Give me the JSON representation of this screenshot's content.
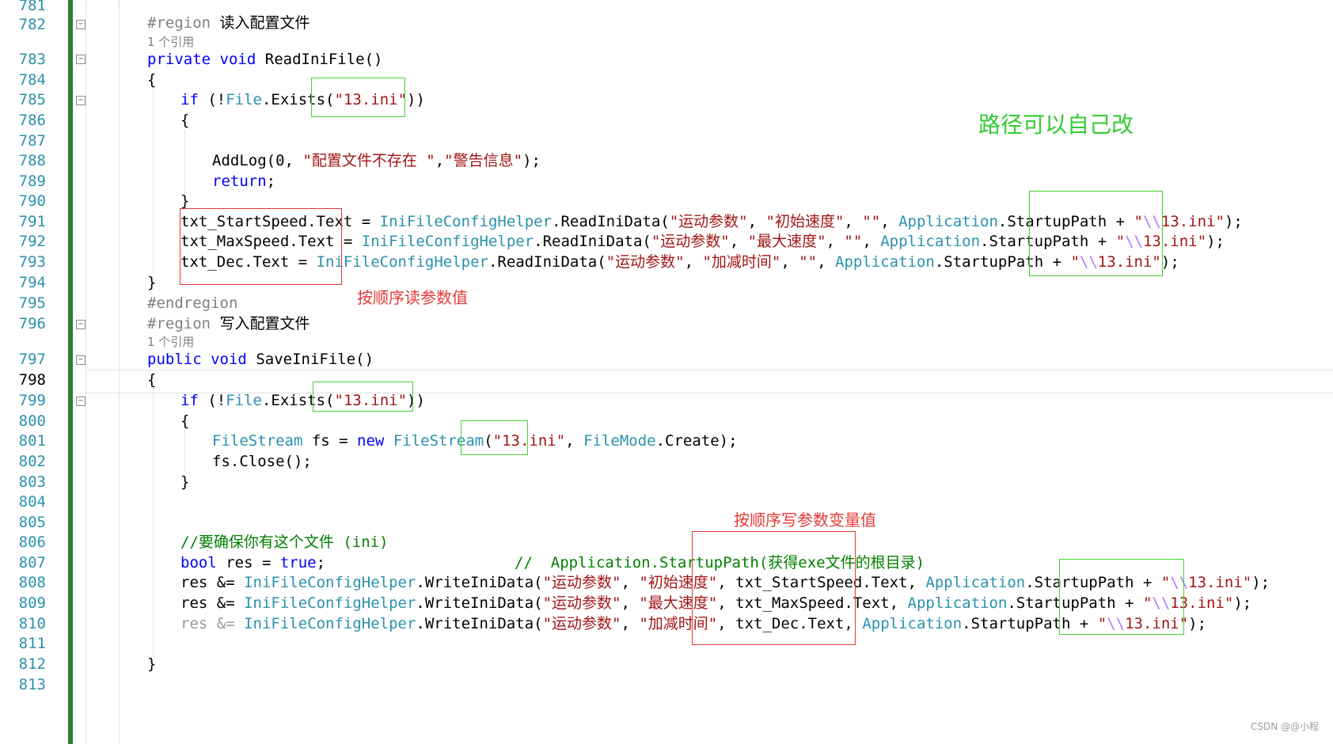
{
  "line_numbers": [
    "781",
    "782",
    "783",
    "784",
    "785",
    "786",
    "787",
    "788",
    "789",
    "790",
    "791",
    "792",
    "793",
    "794",
    "795",
    "796",
    "797",
    "798",
    "799",
    "800",
    "801",
    "802",
    "803",
    "804",
    "805",
    "806",
    "807",
    "808",
    "809",
    "810",
    "811",
    "812",
    "813"
  ],
  "current_line": "798",
  "code": {
    "l782": {
      "pp": "#region",
      "rest": " 读入配置文件"
    },
    "lens1": "1 个引用",
    "l783": {
      "kw1": "private",
      "kw2": "void",
      "name": "ReadIniFile()"
    },
    "l784": "{",
    "l785": {
      "kw": "if",
      "p1": " (!",
      "ty": "File",
      "p2": ".Exists(",
      "st": "\"13.ini\"",
      "p3": "))"
    },
    "l786": "{",
    "l788": {
      "fn": "AddLog(0, ",
      "st1": "\"配置文件不存在 \"",
      "comma": ",",
      "st2": "\"警告信息\"",
      "end": ");"
    },
    "l789": {
      "kw": "return",
      "end": ";"
    },
    "l790": "}",
    "l791": {
      "lhs": "txt_StartSpeed.Text",
      "eq": " = ",
      "ty": "IniFileConfigHelper",
      "call": ".ReadIniData(",
      "s1": "\"运动参数\"",
      "c1": ", ",
      "s2": "\"初始速度\"",
      "c2": ", ",
      "s3": "\"\"",
      "c3": ", ",
      "ty2": "Application",
      "prop": ".StartupPath + ",
      "s4a": "\"",
      "esc": "\\\\",
      "s4b": "13.ini\"",
      "end": ");"
    },
    "l792": {
      "lhs": "txt_MaxSpeed.Text",
      "eq": " = ",
      "ty": "IniFileConfigHelper",
      "call": ".ReadIniData(",
      "s1": "\"运动参数\"",
      "c1": ", ",
      "s2": "\"最大速度\"",
      "c2": ", ",
      "s3": "\"\"",
      "c3": ", ",
      "ty2": "Application",
      "prop": ".StartupPath + ",
      "s4a": "\"",
      "esc": "\\\\",
      "s4b": "13.ini\"",
      "end": ");"
    },
    "l793": {
      "lhs": "txt_Dec.Text",
      "eq": " = ",
      "ty": "IniFileConfigHelper",
      "call": ".ReadIniData(",
      "s1": "\"运动参数\"",
      "c1": ", ",
      "s2": "\"加减时间\"",
      "c2": ", ",
      "s3": "\"\"",
      "c3": ", ",
      "ty2": "Application",
      "prop": ".StartupPath + ",
      "s4a": "\"",
      "esc": "\\\\",
      "s4b": "13.ini\"",
      "end": ");"
    },
    "l794": "}",
    "l795": "#endregion",
    "l796": {
      "pp": "#region",
      "rest": " 写入配置文件"
    },
    "lens2": "1 个引用",
    "l797": {
      "kw1": "public",
      "kw2": "void",
      "name": "SaveIniFile()"
    },
    "l798": "{",
    "l799": {
      "kw": "if",
      "p1": " (!",
      "ty": "File",
      "p2": ".Exists(",
      "st": "\"13.ini\"",
      "p3": "))"
    },
    "l800": "{",
    "l801": {
      "ty1": "FileStream",
      "p1": " fs = ",
      "kw": "new",
      "sp": " ",
      "ty2": "FileStream",
      "p2": "(",
      "st": "\"13.ini\"",
      "p3": ", ",
      "ty3": "FileMode",
      "p4": ".Create);"
    },
    "l802": "fs.Close();",
    "l803": "}",
    "l806": "//要确保你有这个文件 (ini)",
    "l807": {
      "kw": "bool",
      "p1": " res = ",
      "kw2": "true",
      "p2": ";",
      "cm": "//  Application.StartupPath(获得exe文件的根目录)"
    },
    "l808": {
      "lhs": "res &= ",
      "ty": "IniFileConfigHelper",
      "call": ".WriteIniData(",
      "s1": "\"运动参数\"",
      "c1": ", ",
      "s2": "\"初始速度\"",
      "c2": ", ",
      "arg": "txt_StartSpeed.Text",
      "c3": ", ",
      "ty2": "Application",
      "prop": ".StartupPath + ",
      "s4a": "\"",
      "esc": "\\\\",
      "s4b": "13.ini\"",
      "end": ");"
    },
    "l809": {
      "lhs": "res &= ",
      "ty": "IniFileConfigHelper",
      "call": ".WriteIniData(",
      "s1": "\"运动参数\"",
      "c1": ", ",
      "s2": "\"最大速度\"",
      "c2": ", ",
      "arg": "txt_MaxSpeed.Text",
      "c3": ", ",
      "ty2": "Application",
      "prop": ".StartupPath + ",
      "s4a": "\"",
      "esc": "\\\\",
      "s4b": "13.ini\"",
      "end": ");"
    },
    "l810": {
      "lhs": "res &= ",
      "ty": "IniFileConfigHelper",
      "call": ".WriteIniData(",
      "s1": "\"运动参数\"",
      "c1": ", ",
      "s2": "\"加减时间\"",
      "c2": ", ",
      "arg": "txt_Dec.Text",
      "c3": ", ",
      "ty2": "Application",
      "prop": ".StartupPath + ",
      "s4a": "\"",
      "esc": "\\\\",
      "s4b": "13.ini\"",
      "end": ");"
    },
    "l812": "}"
  },
  "annotations": {
    "path_note": "路径可以自己改",
    "read_note": "按顺序读参数值",
    "write_note": "按顺序写参数变量值"
  },
  "watermark": "CSDN @@小程",
  "colors": {
    "keyword": "#0000ff",
    "type": "#2b91af",
    "string": "#a31515",
    "comment": "#008000",
    "red_box": "#e53935",
    "green_box": "#43d62e"
  }
}
